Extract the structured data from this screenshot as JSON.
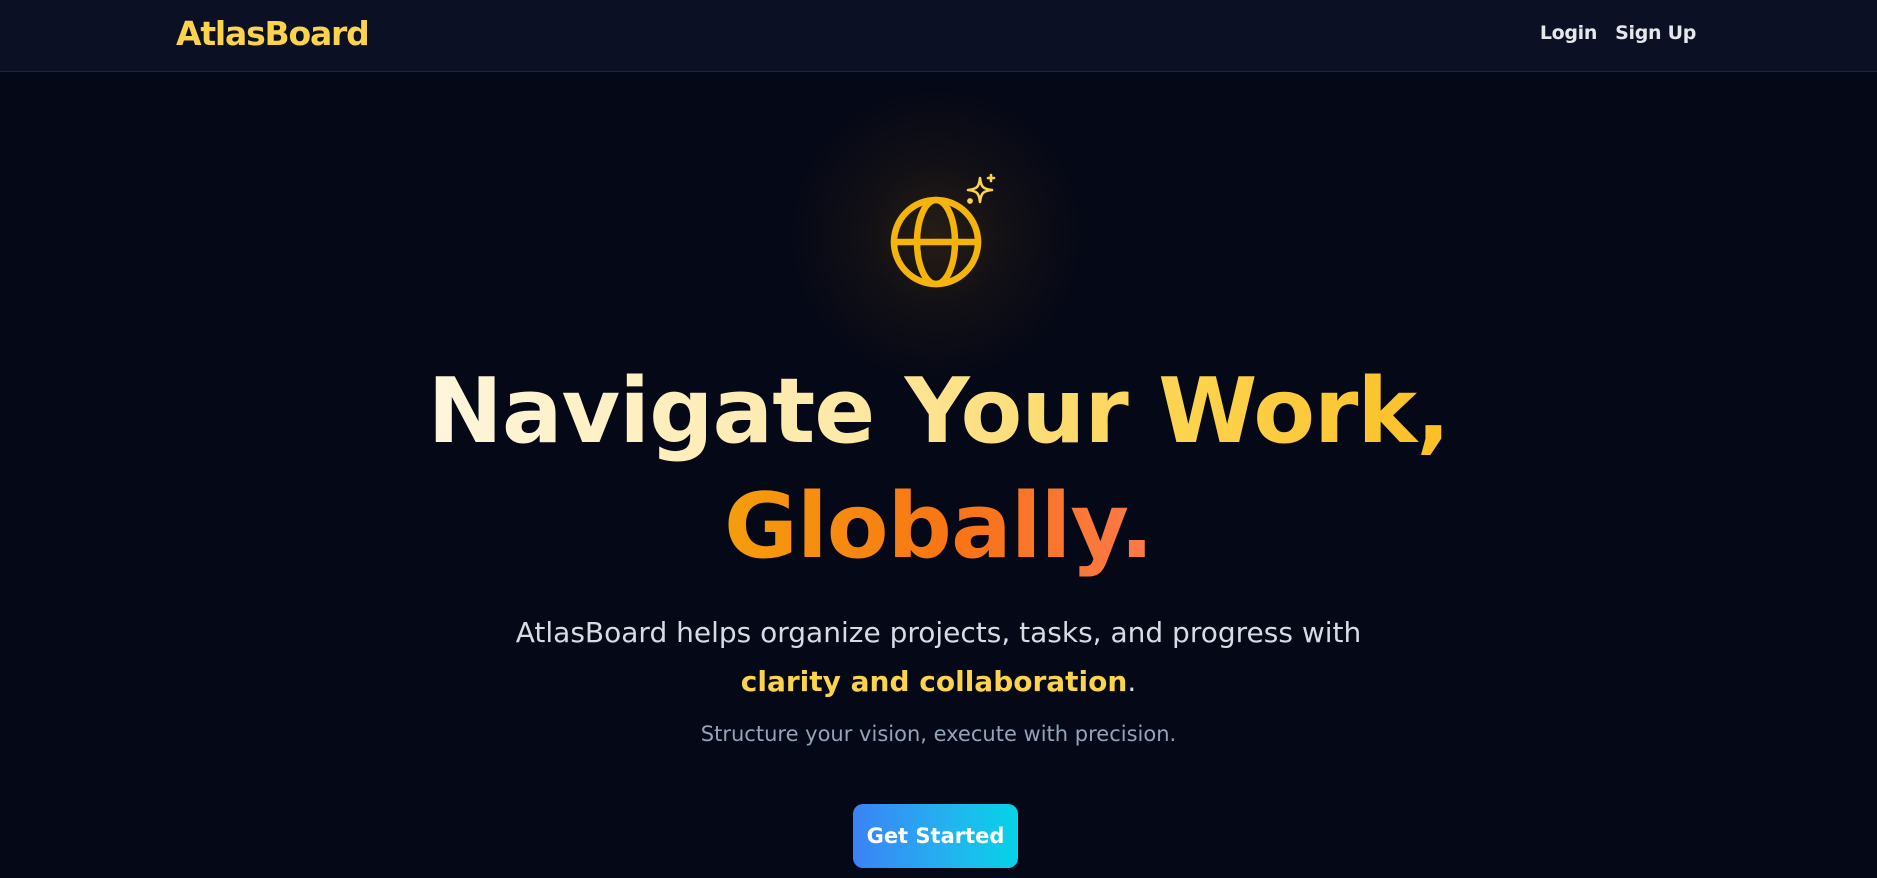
{
  "navbar": {
    "logo": "AtlasBoard",
    "links": [
      {
        "label": "Login"
      },
      {
        "label": "Sign Up"
      }
    ]
  },
  "hero": {
    "icon": "globe-icon",
    "sparkle_icon": "sparkles-icon",
    "headline_line1": "Navigate Your Work,",
    "headline_line2": "Globally.",
    "description_line1": "AtlasBoard helps organize projects, tasks, and progress with",
    "description_highlight": "clarity and collaboration",
    "description_end": ".",
    "tagline": "Structure your vision, execute with precision.",
    "cta_label": "Get Started"
  },
  "colors": {
    "background": "#050816",
    "navbar": "#0b1024",
    "accent_yellow": "#fcd34d",
    "accent_orange": "#f97316",
    "cta_start": "#3b82f6",
    "cta_end": "#06d3e8"
  }
}
